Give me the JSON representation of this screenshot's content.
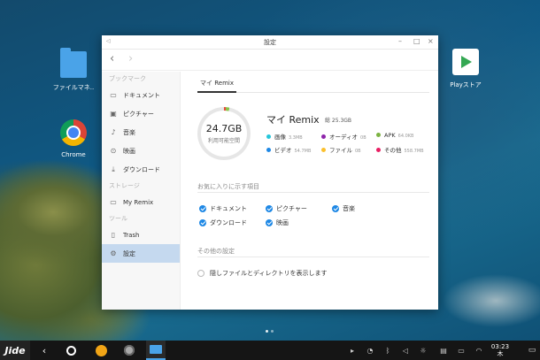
{
  "desktop": {
    "icons": [
      {
        "label": "ファイルマネ..",
        "icon": "folder-icon"
      },
      {
        "label": "Chrome",
        "icon": "chrome-icon"
      },
      {
        "label": "Playストア",
        "icon": "play-store-icon"
      }
    ]
  },
  "window": {
    "title": "設定",
    "controls": {
      "minimize": "–",
      "maximize": "□",
      "close": "×"
    },
    "titlebar_back": "◁",
    "nav": {
      "back": "‹",
      "forward": "›"
    }
  },
  "sidebar": {
    "sections": [
      {
        "title": "ブックマーク",
        "items": [
          {
            "label": "ドキュメント",
            "icon": "folder-icon"
          },
          {
            "label": "ピクチャー",
            "icon": "image-icon"
          },
          {
            "label": "音楽",
            "icon": "music-icon"
          },
          {
            "label": "映画",
            "icon": "video-icon"
          },
          {
            "label": "ダウンロード",
            "icon": "download-icon"
          }
        ]
      },
      {
        "title": "ストレージ",
        "items": [
          {
            "label": "My Remix",
            "icon": "monitor-icon"
          }
        ]
      },
      {
        "title": "ツール",
        "items": [
          {
            "label": "Trash",
            "icon": "trash-icon"
          },
          {
            "label": "設定",
            "icon": "gear-icon",
            "active": true
          }
        ]
      }
    ]
  },
  "content": {
    "tab": "マイ Remix",
    "storage": {
      "available": "24.7GB",
      "available_label": "利用可能空間",
      "volume_name": "マイ Remix",
      "total": "総 25.3GB",
      "used_fraction": 0.03,
      "legend": [
        {
          "label": "画像",
          "size": "3.3MB",
          "color": "#26c6da"
        },
        {
          "label": "オーディオ",
          "size": "0B",
          "color": "#8e24aa"
        },
        {
          "label": "APK",
          "size": "64.0KB",
          "color": "#7cb342"
        },
        {
          "label": "ビデオ",
          "size": "54.7MB",
          "color": "#1e88e5"
        },
        {
          "label": "ファイル",
          "size": "0B",
          "color": "#fbc02d"
        },
        {
          "label": "その他",
          "size": "558.7MB",
          "color": "#e91e63"
        }
      ]
    },
    "favorites": {
      "title": "お気に入りに示す項目",
      "items": [
        "ドキュメント",
        "ピクチャー",
        "音楽",
        "ダウンロード",
        "映画"
      ]
    },
    "other": {
      "title": "その他の設定",
      "show_hidden": "隠しファイルとディレクトリを表示します"
    }
  },
  "taskbar": {
    "logo": "Jide",
    "back": "‹",
    "home": "○",
    "time": "03:23",
    "day": "木"
  }
}
